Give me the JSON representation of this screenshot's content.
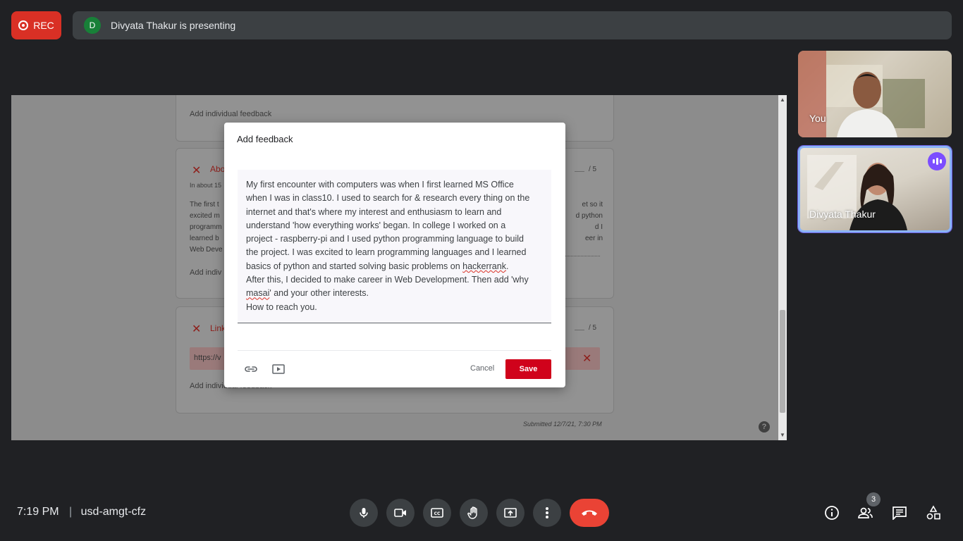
{
  "top_bar": {
    "rec_label": "REC",
    "presenter_initial": "D",
    "presenting_text": "Divyata Thakur is presenting"
  },
  "shared_screen": {
    "card1_link": "Add individual feedback",
    "card2": {
      "title_partial": "Abo",
      "subtitle_partial": "In about 15",
      "max_score": "/ 5",
      "text_left_fragments": [
        "The first t",
        "excited m",
        "programm",
        "learned b",
        "Web Deve"
      ],
      "text_right_fragments": [
        "et so it",
        "d python",
        "d I",
        "eer in"
      ],
      "link": "Add indiv"
    },
    "card3": {
      "title_partial": "Link",
      "max_score": "/ 5",
      "url_partial": "https://v",
      "link": "Add individual feedback"
    },
    "submitted": "Submitted 12/7/21, 7:30 PM",
    "help": "?"
  },
  "dialog": {
    "title": "Add feedback",
    "text_lines": [
      "My first encounter with computers was when I first learned MS Office",
      "when I was in class10. I used to search for & research every thing on the",
      "internet and that's where my interest and enthusiasm to learn and",
      "understand 'how everything works' began.  In college I worked on a",
      "project - raspberry-pi and I used python programming language to build",
      "the project.  I was excited to learn programming languages and I learned",
      "basics of python and started solving basic problems on hackerrank.",
      "After this,  I decided to make career in Web Development. Then add 'why",
      "masai' and your other interests.",
      "How to reach you."
    ],
    "cancel_label": "Cancel",
    "save_label": "Save"
  },
  "participants": [
    {
      "name": "You"
    },
    {
      "name": "Divyata Thakur"
    }
  ],
  "bottom_bar": {
    "time": "7:19 PM",
    "separator": "|",
    "meeting_code": "usd-amgt-cfz",
    "people_count": "3"
  },
  "colors": {
    "rec": "#d93025",
    "save": "#d0021b",
    "hangup": "#ea4335",
    "speaking": "#7c4dff",
    "background": "#202124"
  }
}
